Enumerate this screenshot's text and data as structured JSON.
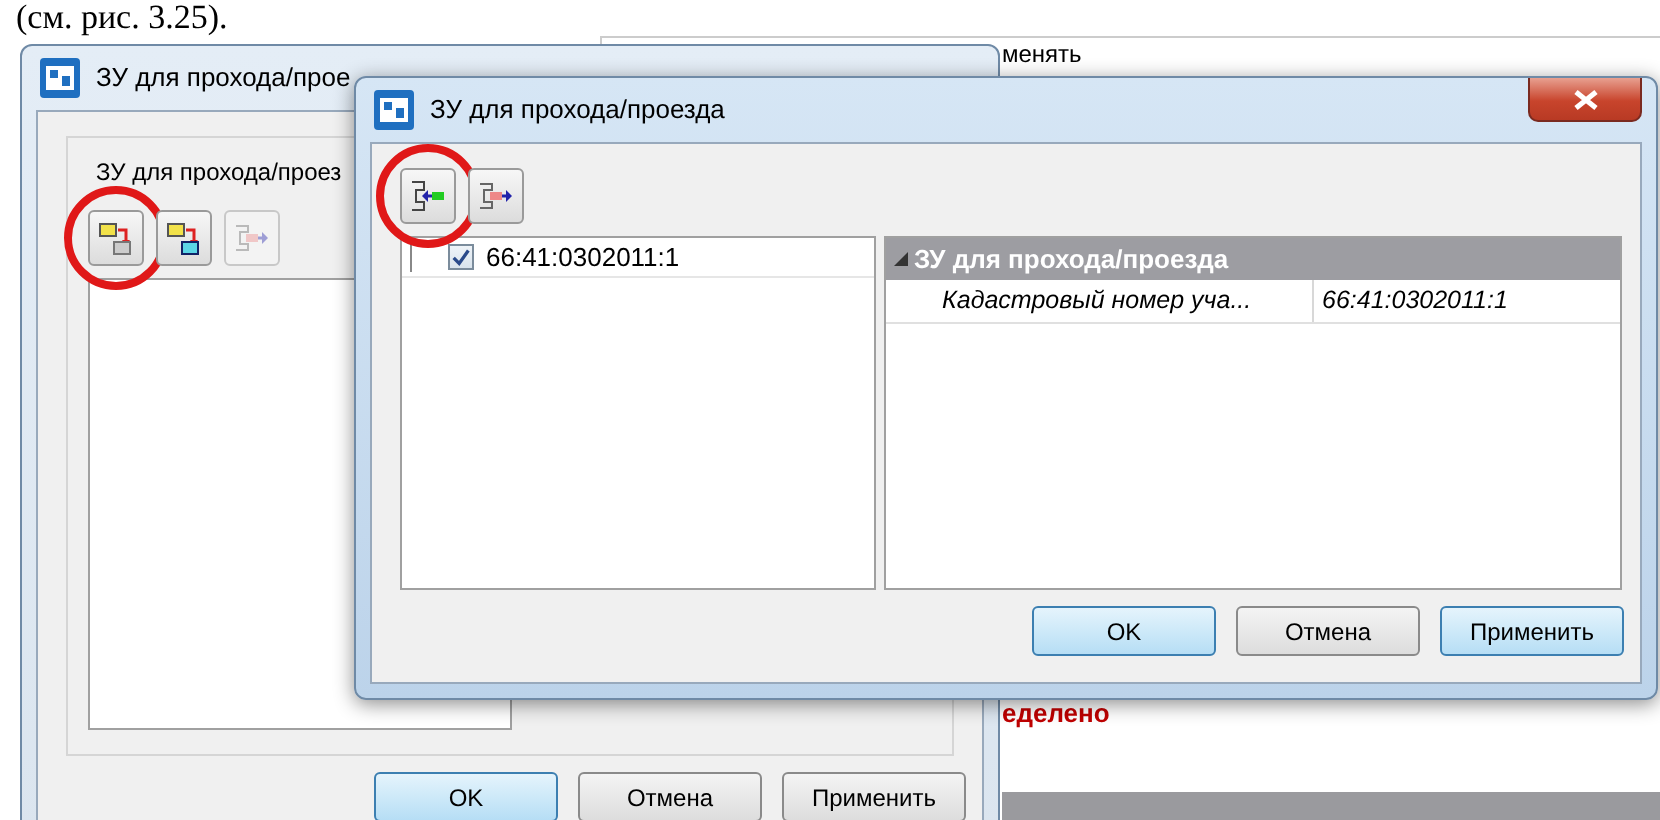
{
  "document_text": "(см. рис. 3.25).",
  "background_app": {
    "texts": [
      {
        "text": "менять",
        "kind": "plain"
      },
      {
        "text": "еделено",
        "kind": "alert"
      }
    ]
  },
  "back_window": {
    "title": "ЗУ для прохода/прое",
    "group_label": "ЗУ для прохода/проез",
    "toolbar": [
      {
        "kind": "move-down",
        "disabled": false,
        "circled": true
      },
      {
        "kind": "move-to",
        "disabled": false,
        "circled": false
      },
      {
        "kind": "export",
        "disabled": true,
        "circled": false
      }
    ],
    "buttons": [
      {
        "label": "OK",
        "highlighted": true
      },
      {
        "label": "Отмена",
        "highlighted": false
      },
      {
        "label": "Применить",
        "highlighted": false
      }
    ]
  },
  "front_window": {
    "title": "ЗУ для прохода/проезда",
    "toolbar": [
      {
        "kind": "import",
        "disabled": false,
        "circled": true
      },
      {
        "kind": "export",
        "disabled": false,
        "circled": false
      }
    ],
    "tree": [
      {
        "label": "66:41:0302011:1",
        "checked": true
      }
    ],
    "properties": {
      "category": "ЗУ для прохода/проезда",
      "expanded": true,
      "rows": [
        {
          "name": "Кадастровый номер уча...",
          "value": "66:41:0302011:1"
        }
      ]
    },
    "buttons": [
      {
        "label": "OK",
        "highlighted": true
      },
      {
        "label": "Отмена",
        "highlighted": false
      },
      {
        "label": "Применить",
        "highlighted": true
      }
    ]
  }
}
